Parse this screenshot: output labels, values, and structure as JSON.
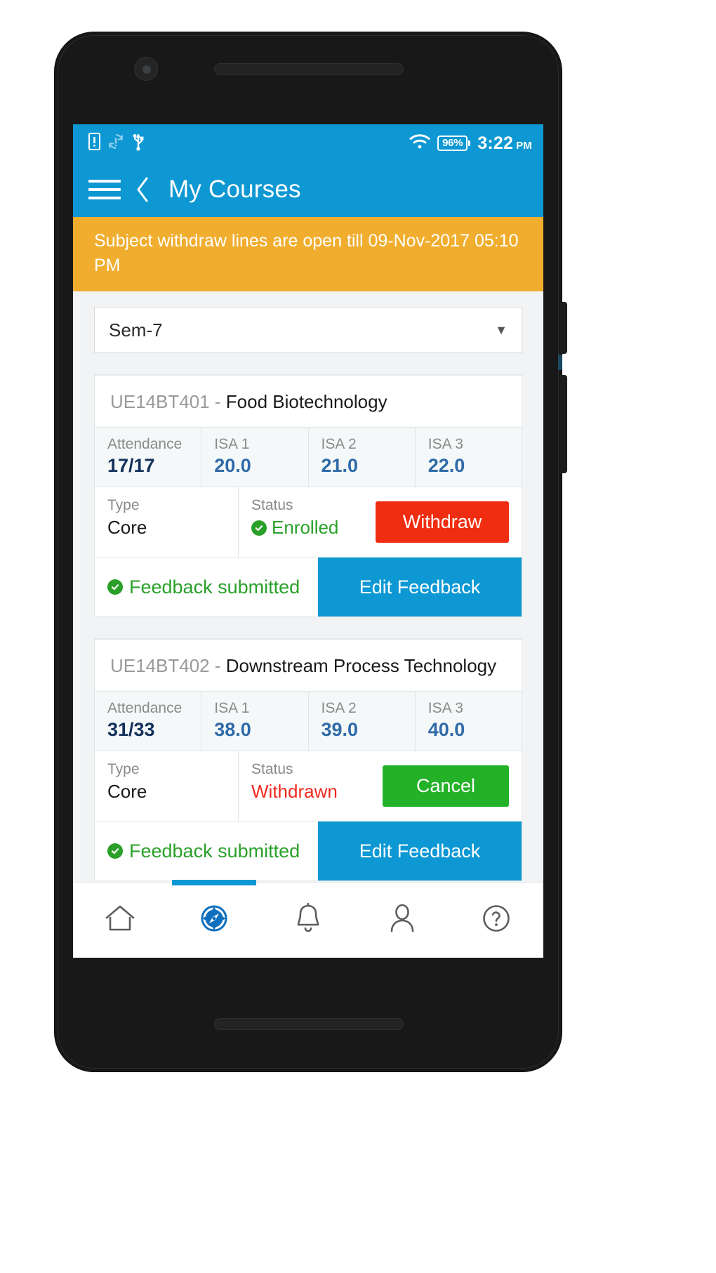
{
  "statusbar": {
    "icons": [
      "sim-alert-icon",
      "sync-problem-icon",
      "usb-icon",
      "wifi-icon"
    ],
    "battery": "96%",
    "time": "3:22",
    "ampm": "PM"
  },
  "appbar": {
    "menu_icon": "hamburger-menu-icon",
    "back_icon": "back-chevron-icon",
    "title": "My Courses"
  },
  "notice": {
    "text": "Subject withdraw lines are open till 09-Nov-2017 05:10 PM"
  },
  "semester_select": {
    "value": "Sem-7",
    "caret": "▼"
  },
  "columns": [
    "Attendance",
    "ISA 1",
    "ISA 2",
    "ISA 3"
  ],
  "labels": {
    "type": "Type",
    "status": "Status",
    "feedback_submitted": "Feedback submitted",
    "edit_feedback": "Edit Feedback"
  },
  "courses": [
    {
      "code": "UE14BT401",
      "separator": " - ",
      "name": "Food Biotechnology",
      "attendance": "17/17",
      "isa1": "20.0",
      "isa2": "21.0",
      "isa3": "22.0",
      "type": "Core",
      "status": "Enrolled",
      "action_label": "Withdraw",
      "feedback": "Feedback submitted",
      "feedback_action": "Edit Feedback"
    },
    {
      "code": "UE14BT402",
      "separator": " - ",
      "name": "Downstream Process Technology",
      "attendance": "31/33",
      "isa1": "38.0",
      "isa2": "39.0",
      "isa3": "40.0",
      "type": "Core",
      "status": "Withdrawn",
      "action_label": "Cancel",
      "feedback": "Feedback submitted",
      "feedback_action": "Edit Feedback"
    }
  ],
  "bottomnav": [
    {
      "icon": "home-icon",
      "active": false
    },
    {
      "icon": "compass-icon",
      "active": true
    },
    {
      "icon": "bell-icon",
      "active": false
    },
    {
      "icon": "person-icon",
      "active": false
    },
    {
      "icon": "help-circle-icon",
      "active": false
    }
  ],
  "colors": {
    "primary_blue": "#0d98d3",
    "banner_orange": "#f0ad2e",
    "withdraw_red": "#f02d10",
    "cancel_green": "#23b128",
    "status_green": "#2aa02a",
    "status_red": "#ef2a21",
    "score_blue": "#2f6aa8"
  }
}
